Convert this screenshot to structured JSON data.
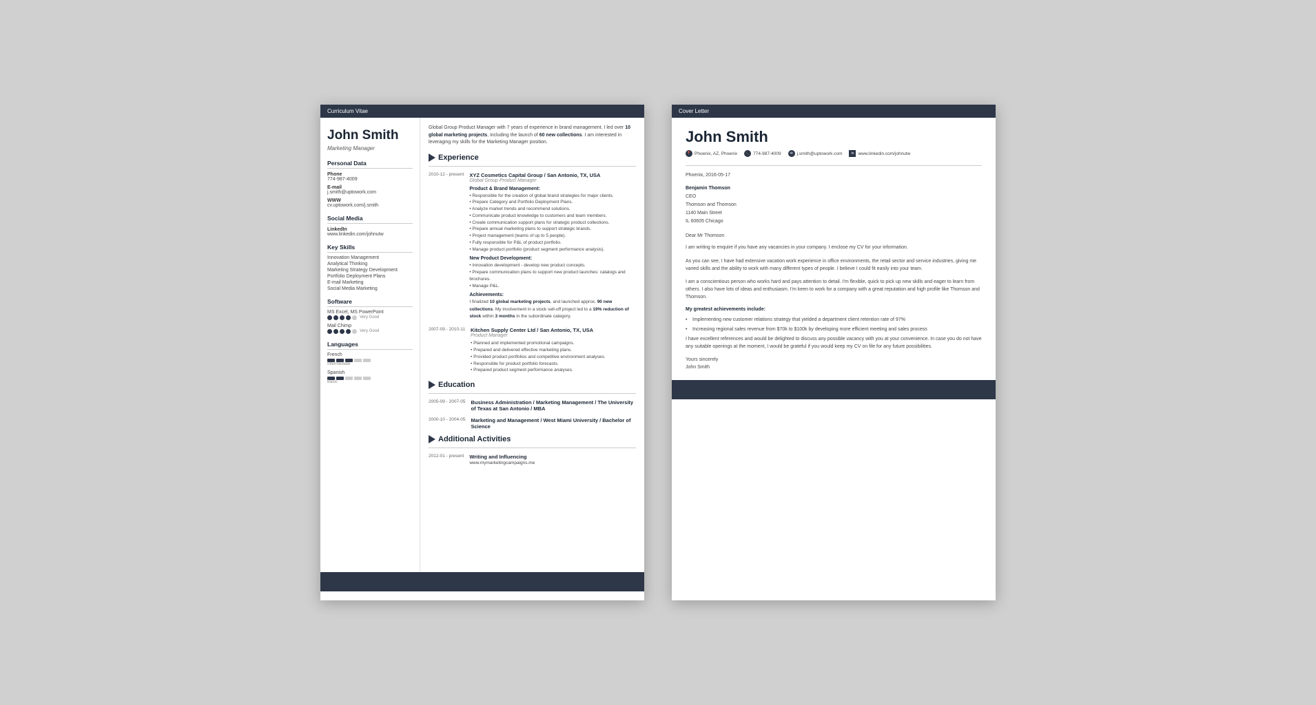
{
  "cv": {
    "header_label": "Curriculum Vitae",
    "name": "John Smith",
    "title": "Marketing Manager",
    "personal": {
      "section": "Personal Data",
      "phone_label": "Phone",
      "phone": "774-987-4009",
      "email_label": "E-mail",
      "email": "j.smith@uptowork.com",
      "www_label": "WWW",
      "www": "cv.uptowork.com/j.smith"
    },
    "social": {
      "section": "Social Media",
      "linkedin_label": "LinkedIn",
      "linkedin": "www.linkedin.com/johnutw"
    },
    "skills": {
      "section": "Key Skills",
      "items": [
        "Innovation Management",
        "Analytical Thinking",
        "Marketing Strategy Development",
        "Portfolio Deployment Plans",
        "E-mail Marketing",
        "Social Media Marketing"
      ]
    },
    "software": {
      "section": "Software",
      "items": [
        {
          "name": "MS Excel, MS PowerPoint",
          "filled": 4,
          "total": 5,
          "label": "Very Good"
        },
        {
          "name": "Mail Chimp",
          "filled": 4,
          "total": 5,
          "label": "Very Good"
        }
      ]
    },
    "languages": {
      "section": "Languages",
      "items": [
        {
          "name": "French",
          "filled": 3,
          "total": 5,
          "label": "Intermediate"
        },
        {
          "name": "Spanish",
          "filled": 2,
          "total": 5,
          "label": "Basic"
        }
      ]
    },
    "summary": "Global Group Product Manager with 7 years of experience in brand management. I led over 10 global marketing projects, including the launch of 60 new collections. I am interested in leveraging my skills for the Marketing Manager position.",
    "experience": {
      "section": "Experience",
      "items": [
        {
          "date": "2010-12 - present",
          "company": "XYZ Cosmetics Capital Group / San Antonio, TX, USA",
          "role": "Global Group Product Manager",
          "subsection1": "Product & Brand Management:",
          "bullets1": [
            "Responsible for the creation of global brand strategies for major clients.",
            "Prepare Category and Portfolio Deployment Plans.",
            "Analyze market trends and recommend solutions.",
            "Communicate product knowledge to customers and team members.",
            "Create communication support plans for strategic product collections.",
            "Prepare annual marketing plans to support strategic brands.",
            "Project management (teams of up to 5 people).",
            "Fully responsible for P&L of product portfolio.",
            "Manage product portfolio (product segment performance analysis)."
          ],
          "subsection2": "New Product Development:",
          "bullets2": [
            "Innovation development - develop new product concepts.",
            "Prepare communication plans to support new product launches: catalogs and brochures.",
            "Manage P&L."
          ],
          "subsection3": "Achievements:",
          "achievements": "I finalized 10 global marketing projects, and launched approx. 90 new collections.\nMy involvement in a stock sell-off project led to a 19% reduction of stock within 3 months in the subordinate category."
        },
        {
          "date": "2007-09 - 2010-11",
          "company": "Kitchen Supply Center Ltd / San Antonio, TX, USA",
          "role": "Product Manager",
          "bullets1": [
            "Planned and implemented promotional campaigns.",
            "Prepared and delivered effective marketing plans.",
            "Provided product portfolios and competitive environment analyses.",
            "Responsible for product portfolio forecasts.",
            "Prepared product segment performance analyses."
          ]
        }
      ]
    },
    "education": {
      "section": "Education",
      "items": [
        {
          "date": "2005-09 - 2007-05",
          "degree": "Business Administration / Marketing Management / The University of Texas at San Antonio / MBA"
        },
        {
          "date": "2000-10 - 2004-05",
          "degree": "Marketing and Management / West Miami University / Bachelor of Science"
        }
      ]
    },
    "activities": {
      "section": "Additional Activities",
      "items": [
        {
          "date": "2012-01 - present",
          "name": "Writing and Influencing",
          "url": "www.mymarketingcampaigns.me"
        }
      ]
    }
  },
  "cl": {
    "header_label": "Cover Letter",
    "name": "John Smith",
    "contact": {
      "location": "Phoenix, AZ, Phoenix",
      "phone": "774-987-4009",
      "email": "j.smith@uptowork.com",
      "linkedin": "www.linkedin.com/johnutw"
    },
    "date": "Phoenix, 2016-05-17",
    "recipient": {
      "name": "Benjamin Thomson",
      "title": "CEO",
      "company": "Thomson and Thomson",
      "address": "1140 Main Street",
      "city": "IL 60605 Chicago"
    },
    "salutation": "Dear Mr Thomson",
    "paragraphs": [
      "I am writing to enquire if you have any vacancies in your company. I enclose my CV for your information.",
      "As you can see, I have had extensive vacation work experience in office environments, the retail sector and service industries, giving me varied skills and the ability to work with many different types of people. I believe I could fit easily into your team.",
      "I am a conscientious person who works hard and pays attention to detail. I'm flexible, quick to pick up new skills and eager to learn from others. I also have lots of ideas and enthusiasm. I'm keen to work for a company with a great reputation and high profile like Thomson and Thomson."
    ],
    "achievements_title": "My greatest achievements include:",
    "achievements": [
      "Implementing new customer relations strategy that yielded a department client retention rate of 97%",
      "Increasing regional sales revenue from $70k to $100k by developing more efficient meeting and sales process"
    ],
    "closing_paragraph": "I have excellent references and would be delighted to discuss any possible vacancy with you at your convenience. In case you do not have any suitable openings at the moment, I would be grateful if you would keep my CV on file for any future possibilities.",
    "closing": "Yours sincerely",
    "signature": "John Smith"
  }
}
